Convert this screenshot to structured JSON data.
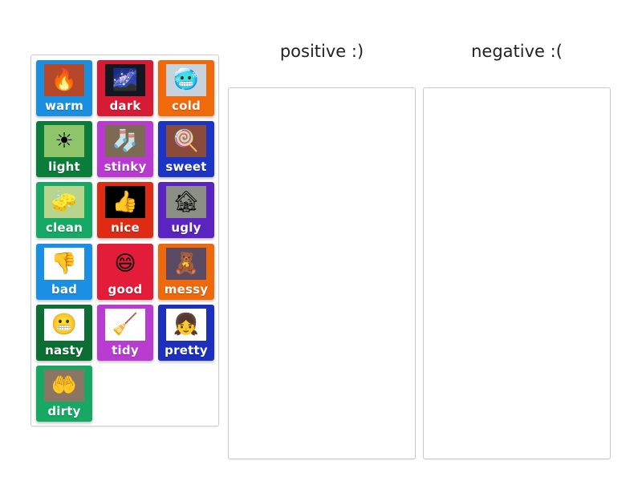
{
  "columns": [
    {
      "title": "positive :)"
    },
    {
      "title": "negative :("
    }
  ],
  "cards": [
    {
      "label": "warm",
      "color": "#1a8fe0",
      "image": "fireplace-socks",
      "glyph": "🔥",
      "pic_bg": "#b5482a"
    },
    {
      "label": "dark",
      "color": "#d81b35",
      "image": "night-sky",
      "glyph": "🌌",
      "pic_bg": "#141622"
    },
    {
      "label": "cold",
      "color": "#f06a0c",
      "image": "frozen-person",
      "glyph": "🥶",
      "pic_bg": "#c7d3dc"
    },
    {
      "label": "light",
      "color": "#0b7d3a",
      "image": "sunny-grass",
      "glyph": "☀",
      "pic_bg": "#8fc46a"
    },
    {
      "label": "stinky",
      "color": "#b83ad0",
      "image": "smelly-man",
      "glyph": "🧦",
      "pic_bg": "#7c6a55"
    },
    {
      "label": "sweet",
      "color": "#1c35c4",
      "image": "candy-shop",
      "glyph": "🍭",
      "pic_bg": "#8a4b3b"
    },
    {
      "label": "clean",
      "color": "#16a865",
      "image": "window-cleaning",
      "glyph": "🧽",
      "pic_bg": "#b9d48c"
    },
    {
      "label": "nice",
      "color": "#df2a14",
      "image": "very-nice-thumb",
      "glyph": "👍",
      "pic_bg": "#000000"
    },
    {
      "label": "ugly",
      "color": "#5b24c0",
      "image": "old-house",
      "glyph": "🏚",
      "pic_bg": "#8b8f86"
    },
    {
      "label": "bad",
      "color": "#1b8fe3",
      "image": "thumbs-down",
      "glyph": "👎",
      "pic_bg": "#ffffff"
    },
    {
      "label": "good",
      "color": "#e31c3a",
      "image": "smiley-thumbs-up",
      "glyph": "😄",
      "pic_bg": "#e31c3a"
    },
    {
      "label": "messy",
      "color": "#ee680c",
      "image": "messy-room",
      "glyph": "🧸",
      "pic_bg": "#5a4a64"
    },
    {
      "label": "nasty",
      "color": "#0b6e32",
      "image": "angry-emoji",
      "glyph": "😬",
      "pic_bg": "#ffffff"
    },
    {
      "label": "tidy",
      "color": "#b73ccf",
      "image": "girl-sweeping",
      "glyph": "🧹",
      "pic_bg": "#ffffff"
    },
    {
      "label": "pretty",
      "color": "#1c2fbd",
      "image": "pretty-girl",
      "glyph": "👧",
      "pic_bg": "#ffffff"
    },
    {
      "label": "dirty",
      "color": "#17a864",
      "image": "dirty-hands",
      "glyph": "🤲",
      "pic_bg": "#8b7665"
    }
  ]
}
